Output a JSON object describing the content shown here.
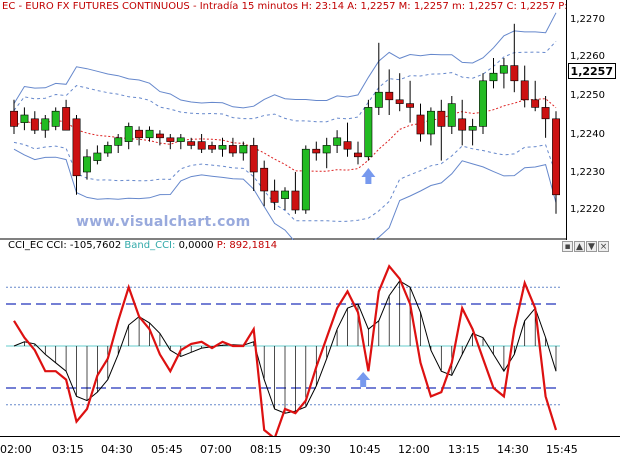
{
  "header": {
    "symbol": "EC",
    "title": "EURO FX FUTURES CONTINUOUS",
    "timeframe": "Intradía 15 minutos",
    "h_label": "H:",
    "h_value": "23:14",
    "a_label": "A:",
    "a_value": "1,2257",
    "m_label": "M:",
    "m_value": "1,2257",
    "mi_label": "m:",
    "mi_value": "1,2257",
    "c_label": "C:",
    "c_value": "1,2257",
    "p_label": "P:"
  },
  "price_axis": {
    "labels": [
      "1,2270",
      "1,2260",
      "1,2250",
      "1,2240",
      "1,2230",
      "1,2220"
    ],
    "last_price": "1,2257"
  },
  "watermark": "www.visualchart.com",
  "cci_header": {
    "name": "CCI_EC",
    "cci_label": "CCI:",
    "cci_value": "-105,7602",
    "band_label": "Band_CCI:",
    "band_value": "0,0000",
    "p_label": "P:",
    "p_value": "892,1814"
  },
  "time_axis": [
    "02:00",
    "03:15",
    "04:30",
    "05:45",
    "07:00",
    "08:15",
    "09:30",
    "10:45",
    "12:00",
    "13:15",
    "14:30",
    "15:45"
  ],
  "controls": {
    "close": "×",
    "up": "▲",
    "down": "▼",
    "pin": "▪"
  },
  "colors": {
    "bull": "#22bb22",
    "bear": "#cc1111",
    "band": "#6688cc",
    "mid": "#dd2222",
    "cci": "#dd1111",
    "signal": "#000000",
    "arrow": "#7799ee",
    "cyan": "#66cccc"
  },
  "chart_data": [
    {
      "type": "candlestick",
      "title": "EURO FX FUTURES CONTINUOUS",
      "ylim": [
        1.2215,
        1.2275
      ],
      "candles": [
        {
          "o": 1.2246,
          "h": 1.2249,
          "l": 1.224,
          "c": 1.2242
        },
        {
          "o": 1.2243,
          "h": 1.2247,
          "l": 1.2241,
          "c": 1.2245
        },
        {
          "o": 1.2244,
          "h": 1.2246,
          "l": 1.224,
          "c": 1.2241
        },
        {
          "o": 1.2241,
          "h": 1.2245,
          "l": 1.2239,
          "c": 1.2244
        },
        {
          "o": 1.2242,
          "h": 1.2247,
          "l": 1.2241,
          "c": 1.2246
        },
        {
          "o": 1.2247,
          "h": 1.2249,
          "l": 1.2243,
          "c": 1.2241
        },
        {
          "o": 1.2244,
          "h": 1.2245,
          "l": 1.2224,
          "c": 1.2229
        },
        {
          "o": 1.223,
          "h": 1.2236,
          "l": 1.2228,
          "c": 1.2234
        },
        {
          "o": 1.2233,
          "h": 1.2237,
          "l": 1.2232,
          "c": 1.2235
        },
        {
          "o": 1.2235,
          "h": 1.2238,
          "l": 1.2234,
          "c": 1.2237
        },
        {
          "o": 1.2237,
          "h": 1.224,
          "l": 1.2235,
          "c": 1.2239
        },
        {
          "o": 1.2238,
          "h": 1.2243,
          "l": 1.2236,
          "c": 1.2242
        },
        {
          "o": 1.2241,
          "h": 1.2242,
          "l": 1.2237,
          "c": 1.2239
        },
        {
          "o": 1.2239,
          "h": 1.2242,
          "l": 1.2238,
          "c": 1.2241
        },
        {
          "o": 1.224,
          "h": 1.2241,
          "l": 1.2237,
          "c": 1.2239
        },
        {
          "o": 1.2239,
          "h": 1.224,
          "l": 1.2236,
          "c": 1.2238
        },
        {
          "o": 1.2238,
          "h": 1.224,
          "l": 1.2236,
          "c": 1.2239
        },
        {
          "o": 1.2238,
          "h": 1.2239,
          "l": 1.2236,
          "c": 1.2237
        },
        {
          "o": 1.2238,
          "h": 1.224,
          "l": 1.2235,
          "c": 1.2236
        },
        {
          "o": 1.2237,
          "h": 1.2238,
          "l": 1.2235,
          "c": 1.2236
        },
        {
          "o": 1.2236,
          "h": 1.2239,
          "l": 1.2234,
          "c": 1.2237
        },
        {
          "o": 1.2237,
          "h": 1.2239,
          "l": 1.2234,
          "c": 1.2235
        },
        {
          "o": 1.2235,
          "h": 1.2238,
          "l": 1.2233,
          "c": 1.2237
        },
        {
          "o": 1.2237,
          "h": 1.2239,
          "l": 1.2225,
          "c": 1.223
        },
        {
          "o": 1.2231,
          "h": 1.2233,
          "l": 1.2221,
          "c": 1.2225
        },
        {
          "o": 1.2225,
          "h": 1.2228,
          "l": 1.222,
          "c": 1.2222
        },
        {
          "o": 1.2223,
          "h": 1.2226,
          "l": 1.222,
          "c": 1.2225
        },
        {
          "o": 1.2225,
          "h": 1.223,
          "l": 1.2219,
          "c": 1.222
        },
        {
          "o": 1.222,
          "h": 1.2237,
          "l": 1.2219,
          "c": 1.2236
        },
        {
          "o": 1.2236,
          "h": 1.2238,
          "l": 1.2233,
          "c": 1.2235
        },
        {
          "o": 1.2235,
          "h": 1.2239,
          "l": 1.2231,
          "c": 1.2237
        },
        {
          "o": 1.2237,
          "h": 1.2241,
          "l": 1.2235,
          "c": 1.2239
        },
        {
          "o": 1.2238,
          "h": 1.2243,
          "l": 1.2234,
          "c": 1.2236
        },
        {
          "o": 1.2235,
          "h": 1.2238,
          "l": 1.2232,
          "c": 1.2234
        },
        {
          "o": 1.2234,
          "h": 1.2249,
          "l": 1.2233,
          "c": 1.2247
        },
        {
          "o": 1.2247,
          "h": 1.2264,
          "l": 1.2245,
          "c": 1.2251
        },
        {
          "o": 1.2251,
          "h": 1.2257,
          "l": 1.2245,
          "c": 1.2249
        },
        {
          "o": 1.2249,
          "h": 1.2256,
          "l": 1.2246,
          "c": 1.2248
        },
        {
          "o": 1.2248,
          "h": 1.2254,
          "l": 1.2243,
          "c": 1.2247
        },
        {
          "o": 1.2245,
          "h": 1.2248,
          "l": 1.2238,
          "c": 1.224
        },
        {
          "o": 1.224,
          "h": 1.2247,
          "l": 1.2237,
          "c": 1.2246
        },
        {
          "o": 1.2246,
          "h": 1.2249,
          "l": 1.2233,
          "c": 1.2242
        },
        {
          "o": 1.2242,
          "h": 1.225,
          "l": 1.224,
          "c": 1.2248
        },
        {
          "o": 1.2244,
          "h": 1.2249,
          "l": 1.2237,
          "c": 1.2241
        },
        {
          "o": 1.2241,
          "h": 1.2244,
          "l": 1.2237,
          "c": 1.2242
        },
        {
          "o": 1.2242,
          "h": 1.2256,
          "l": 1.224,
          "c": 1.2254
        },
        {
          "o": 1.2254,
          "h": 1.226,
          "l": 1.2252,
          "c": 1.2256
        },
        {
          "o": 1.2256,
          "h": 1.226,
          "l": 1.2252,
          "c": 1.2258
        },
        {
          "o": 1.2258,
          "h": 1.2269,
          "l": 1.2251,
          "c": 1.2254
        },
        {
          "o": 1.2254,
          "h": 1.2258,
          "l": 1.2247,
          "c": 1.2249
        },
        {
          "o": 1.2249,
          "h": 1.2254,
          "l": 1.2246,
          "c": 1.2247
        },
        {
          "o": 1.2247,
          "h": 1.225,
          "l": 1.2239,
          "c": 1.2244
        },
        {
          "o": 1.2244,
          "h": 1.2246,
          "l": 1.2219,
          "c": 1.2224
        }
      ]
    },
    {
      "type": "line",
      "title": "CCI_EC",
      "ylim": [
        -200,
        250
      ],
      "series": [
        {
          "name": "CCI",
          "values": [
            60,
            20,
            -10,
            -60,
            -60,
            -80,
            -180,
            -150,
            -70,
            -30,
            60,
            140,
            70,
            40,
            -20,
            -60,
            -10,
            5,
            10,
            -5,
            10,
            0,
            0,
            40,
            -200,
            -220,
            -150,
            -160,
            -130,
            -50,
            20,
            90,
            130,
            80,
            -60,
            130,
            190,
            160,
            100,
            -40,
            -120,
            -110,
            -40,
            90,
            40,
            -30,
            -100,
            -120,
            40,
            150,
            90,
            -120,
            -200
          ]
        },
        {
          "name": "Band_CCI",
          "values": [
            0,
            10,
            5,
            -20,
            -40,
            -60,
            -120,
            -130,
            -110,
            -80,
            -20,
            50,
            70,
            55,
            30,
            -10,
            -25,
            -15,
            -5,
            -2,
            2,
            3,
            2,
            10,
            -80,
            -150,
            -160,
            -155,
            -145,
            -95,
            -30,
            40,
            90,
            100,
            40,
            60,
            120,
            155,
            140,
            80,
            -10,
            -60,
            -70,
            -20,
            30,
            20,
            -20,
            -60,
            -20,
            60,
            90,
            20,
            -60
          ]
        }
      ]
    }
  ]
}
